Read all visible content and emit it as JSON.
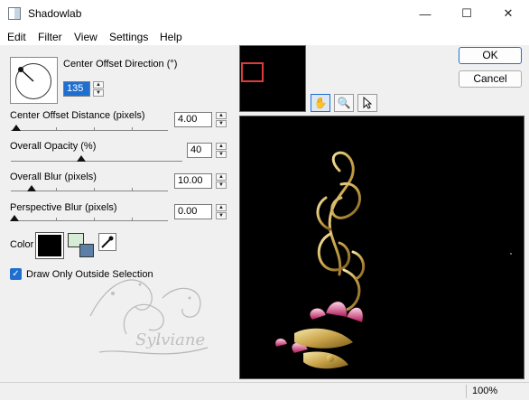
{
  "window": {
    "title": "Shadowlab"
  },
  "window_controls": {
    "minimize": "—",
    "maximize": "☐",
    "close": "✕"
  },
  "menu": {
    "items": [
      "Edit",
      "Filter",
      "View",
      "Settings",
      "Help"
    ]
  },
  "controls": {
    "direction": {
      "label": "Center Offset Direction (°)",
      "value": "135"
    },
    "offset_distance": {
      "label": "Center Offset Distance (pixels)",
      "value": "4.00",
      "level": 0.05
    },
    "opacity": {
      "label": "Overall Opacity (%)",
      "value": "40",
      "level": 0.4
    },
    "blur": {
      "label": "Overall Blur (pixels)",
      "value": "10.00",
      "level": 0.1
    },
    "perspective_blur": {
      "label": "Perspective Blur (pixels)",
      "value": "0.00",
      "level": 0.0
    }
  },
  "color": {
    "label": "Color",
    "primary": "#000000",
    "secondary_a": "#d6ecd6",
    "secondary_b": "#5b7fa6"
  },
  "draw_only_outside": {
    "label": "Draw Only Outside Selection",
    "checked": true
  },
  "buttons": {
    "ok": "OK",
    "cancel": "Cancel"
  },
  "tools": [
    "hand-icon",
    "zoom-icon",
    "pointer-icon"
  ],
  "status": {
    "zoom": "100%"
  },
  "watermark": {
    "signature": "Sylviane"
  },
  "colors": {
    "accent": "#1f6fd1",
    "selection_rect": "#e03a3a"
  }
}
